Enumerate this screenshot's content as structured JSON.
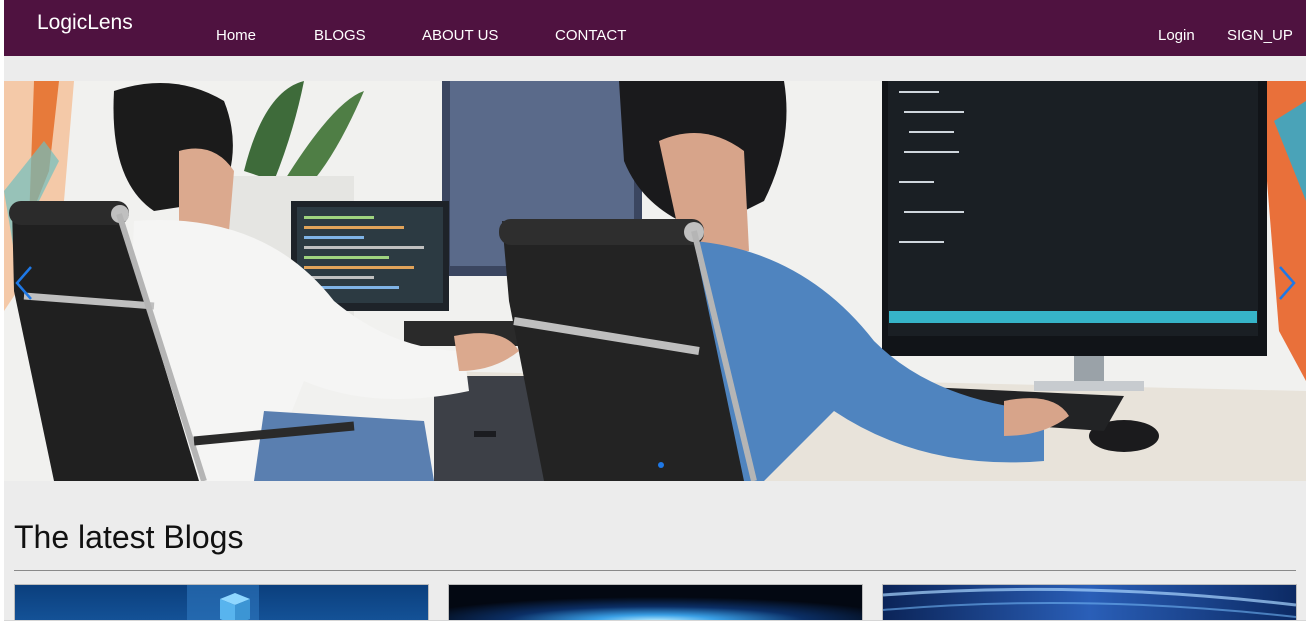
{
  "navbar": {
    "brand": "LogicLens",
    "links": [
      "Home",
      "BLOGS",
      "ABOUT US",
      "CONTACT"
    ],
    "login_label": "Login",
    "signup_label": "SIGN_UP",
    "background": "#4f1240"
  },
  "carousel": {
    "prev_icon": "chevron-left-icon",
    "next_icon": "chevron-right-icon",
    "active_slide": 1,
    "accent": "#1e78e6"
  },
  "latest": {
    "title": "The latest Blogs"
  }
}
